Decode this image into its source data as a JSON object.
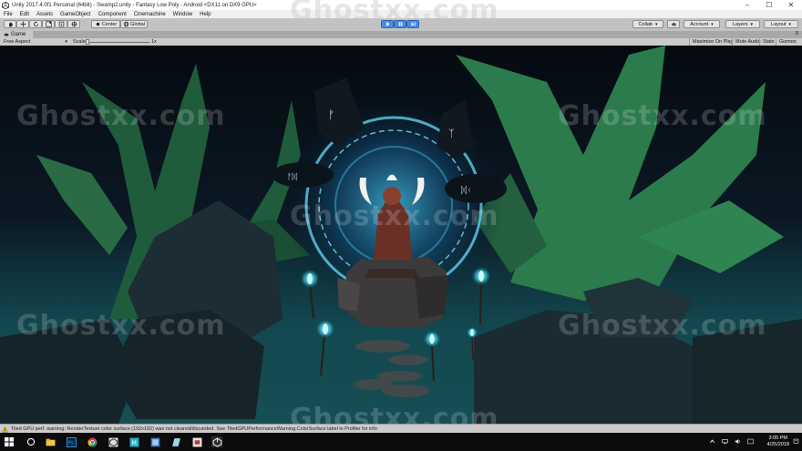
{
  "window": {
    "title": "Unity 2017.4.0f1 Personal (64bit) - Swamp2.unity - Fantasy Low Poly - Android <DX11 on DX9 GPU>"
  },
  "menu": [
    "File",
    "Edit",
    "Assets",
    "GameObject",
    "Component",
    "Cinemachine",
    "Window",
    "Help"
  ],
  "toolbar": {
    "pivot_label": "Center",
    "space_label": "Global",
    "collab_label": "Collab",
    "account_label": "Account",
    "layers_label": "Layers",
    "layout_label": "Layout",
    "play_active": true
  },
  "game_tab": {
    "label": "Game"
  },
  "game_controls": {
    "aspect_label": "Free Aspect",
    "scale_label": "Scale",
    "scale_value": "1x",
    "maximize_label": "Maximize On Play",
    "mute_label": "Mute Audio",
    "stats_label": "Stats",
    "gizmos_label": "Gizmos"
  },
  "status": {
    "message": "Tiled GPU perf. warning: RenderTexture color surface (192x192) was not cleared/discarded. See TiledGPUPerformanceWarning.ColorSurface label in Profiler for info"
  },
  "taskbar": {
    "time": "3:05 PM",
    "date": "4/25/2018"
  },
  "watermark": "Ghostxx.com",
  "colors": {
    "play_accent": "#4a8de0",
    "portal_glow": "#7ee6ff",
    "tree_green": "#2f7a4a",
    "torch_flame": "#8ff2ff"
  }
}
